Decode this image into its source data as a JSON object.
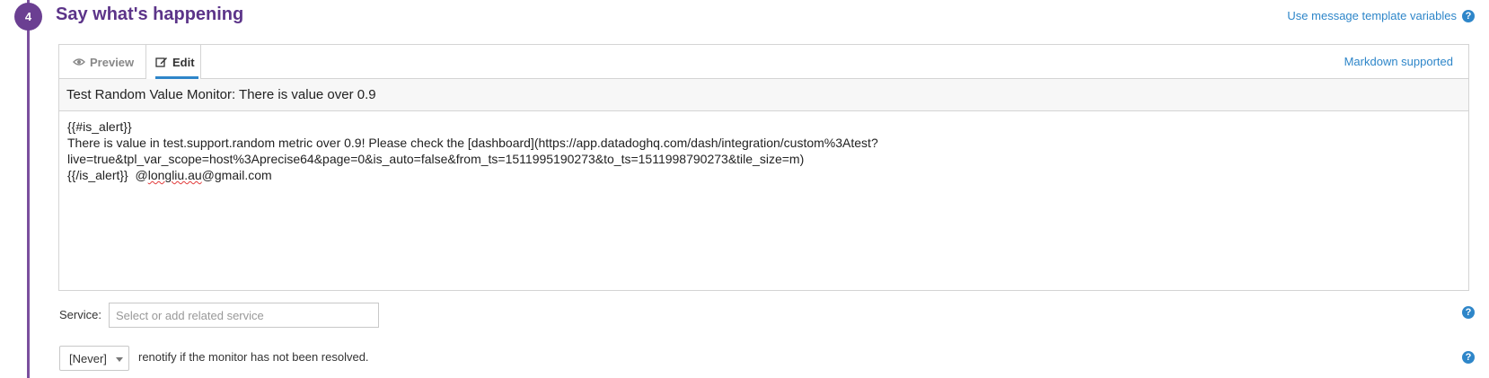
{
  "step": {
    "number": "4",
    "title": "Say what's happening"
  },
  "header": {
    "template_link": "Use message template variables",
    "help": "?"
  },
  "editor": {
    "tabs": [
      {
        "label": "Preview",
        "icon": "eye-icon"
      },
      {
        "label": "Edit",
        "icon": "edit-icon"
      }
    ],
    "active_tab": "Edit",
    "markdown_note": "Markdown supported",
    "title_value": "Test Random Value Monitor: There is value over 0.9",
    "message_lines": [
      "{{#is_alert}}",
      "There is value in test.support.random metric over 0.9! Please check the [dashboard](https://app.datadoghq.com/dash/integration/custom%3Atest?",
      "live=true&tpl_var_scope=host%3Aprecise64&page=0&is_auto=false&from_ts=1511995190273&to_ts=1511998790273&tile_size=m)"
    ],
    "last_line": {
      "prefix": "{{/is_alert}}  @",
      "misspelled": "longliu.au",
      "suffix": "@gmail.com"
    }
  },
  "service": {
    "label": "Service:",
    "placeholder": "Select or add related service",
    "help": "?"
  },
  "renotify": {
    "selected": "[Never]",
    "text": "renotify if the monitor has not been resolved.",
    "help": "?"
  },
  "colors": {
    "accent_purple": "#6b3f92",
    "link_blue": "#2e86c9"
  }
}
